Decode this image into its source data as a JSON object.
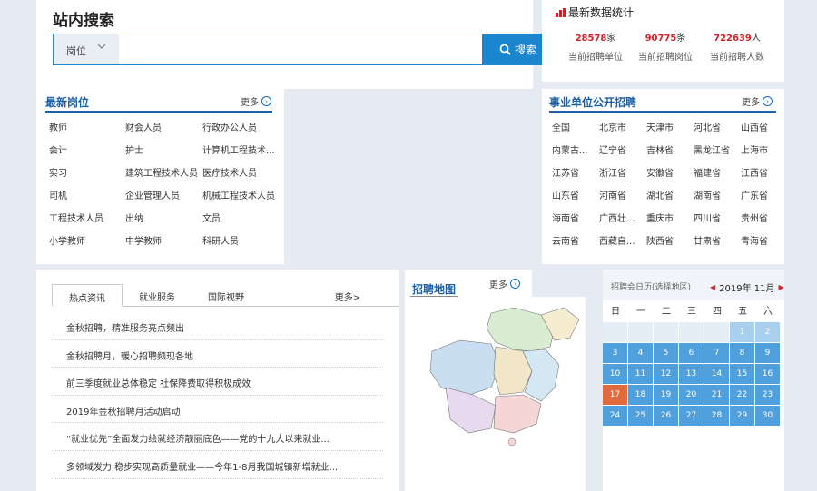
{
  "search": {
    "title": "站内搜索",
    "category": "岗位",
    "input_value": "",
    "button_label": "搜索"
  },
  "stats": {
    "title": "最新数据统计",
    "items": [
      {
        "value": "28578",
        "unit": "家",
        "label": "当前招聘单位"
      },
      {
        "value": "90775",
        "unit": "条",
        "label": "当前招聘岗位"
      },
      {
        "value": "722639",
        "unit": "人",
        "label": "当前招聘人数"
      }
    ]
  },
  "jobs": {
    "title": "最新岗位",
    "more": "更多",
    "items": [
      "教师",
      "财会人员",
      "行政办公人员",
      "会计",
      "护士",
      "计算机工程技术...",
      "实习",
      "建筑工程技术人员",
      "医疗技术人员",
      "司机",
      "企业管理人员",
      "机械工程技术人员",
      "工程技术人员",
      "出纳",
      "文员",
      "小学教师",
      "中学教师",
      "科研人员"
    ]
  },
  "units": {
    "title": "事业单位公开招聘",
    "more": "更多",
    "items": [
      "全国",
      "北京市",
      "天津市",
      "河北省",
      "山西省",
      "内蒙古...",
      "辽宁省",
      "吉林省",
      "黑龙江省",
      "上海市",
      "江苏省",
      "浙江省",
      "安徽省",
      "福建省",
      "江西省",
      "山东省",
      "河南省",
      "湖北省",
      "湖南省",
      "广东省",
      "海南省",
      "广西壮...",
      "重庆市",
      "四川省",
      "贵州省",
      "云南省",
      "西藏自...",
      "陕西省",
      "甘肃省",
      "青海省"
    ]
  },
  "news": {
    "tabs": [
      "热点资讯",
      "就业服务",
      "国际视野"
    ],
    "more": "更多>",
    "items": [
      "金秋招聘，精准服务亮点频出",
      "金秋招聘月，暖心招聘频现各地",
      "前三季度就业总体稳定 社保降费取得积极成效",
      "2019年金秋招聘月活动启动",
      "“就业优先”全面发力绘就经济靓丽底色——党的十九大以来就业...",
      "多领域发力 稳步实现高质量就业——今年1-8月我国城镇新增就业..."
    ]
  },
  "map": {
    "title": "招聘地图",
    "more": "更多"
  },
  "calendar": {
    "title": "招聘会日历(选择地区)",
    "month": "2019年 11月",
    "weekdays": [
      "日",
      "一",
      "二",
      "三",
      "四",
      "五",
      "六"
    ],
    "days": [
      "",
      "",
      "",
      "",
      "",
      "1",
      "2",
      "3",
      "4",
      "5",
      "6",
      "7",
      "8",
      "9",
      "10",
      "11",
      "12",
      "13",
      "14",
      "15",
      "16",
      "17",
      "18",
      "19",
      "20",
      "21",
      "22",
      "23",
      "24",
      "25",
      "26",
      "27",
      "28",
      "29",
      "30"
    ],
    "today": "17",
    "colors": {
      "active": "#4fa0dc",
      "past": "#a8d0ee",
      "today": "#e06a3b"
    }
  }
}
